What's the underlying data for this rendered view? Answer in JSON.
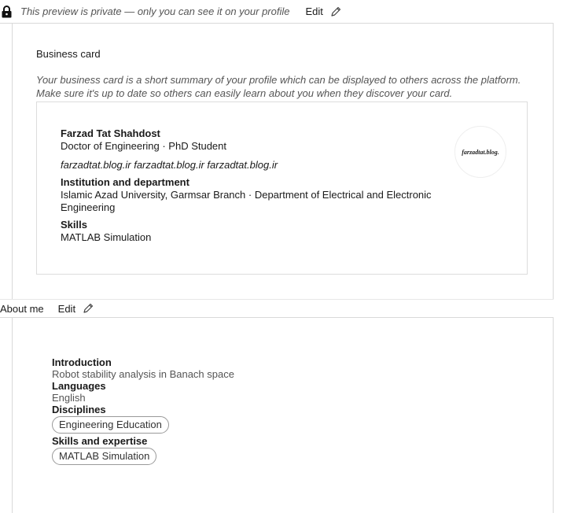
{
  "privacy_notice": {
    "text": "This preview is private — only you can see it on your profile",
    "edit_label": "Edit"
  },
  "business_card": {
    "heading": "Business card",
    "description": "Your business card is a short summary of your profile which can be displayed to others across the platform. Make sure it's up to date so others can easily learn about you when they discover your card.",
    "name": "Farzad Tat Shahdost",
    "subtitle": "Doctor of Engineering · PhD Student",
    "links": "farzadtat.blog.ir farzadtat.blog.ir farzadtat.blog.ir",
    "institution_label": "Institution and department",
    "institution_value": "Islamic Azad University, Garmsar Branch · Department of Electrical and Electronic Engineering",
    "skills_label": "Skills",
    "skills_value": "MATLAB Simulation",
    "avatar_text": "farzadtat.blog."
  },
  "about_me": {
    "title": "About me",
    "edit_label": "Edit",
    "introduction_label": "Introduction",
    "introduction_value": "Robot stability analysis in Banach space",
    "languages_label": "Languages",
    "languages_value": "English",
    "disciplines_label": "Disciplines",
    "disciplines": [
      "Engineering Education"
    ],
    "skills_label": "Skills and expertise",
    "skills": [
      "MATLAB Simulation"
    ]
  },
  "colors": {
    "border": "#d9d9d9",
    "muted_text": "#555555",
    "text": "#1a1a1a"
  },
  "icons": [
    "lock-icon",
    "pencil-icon"
  ]
}
